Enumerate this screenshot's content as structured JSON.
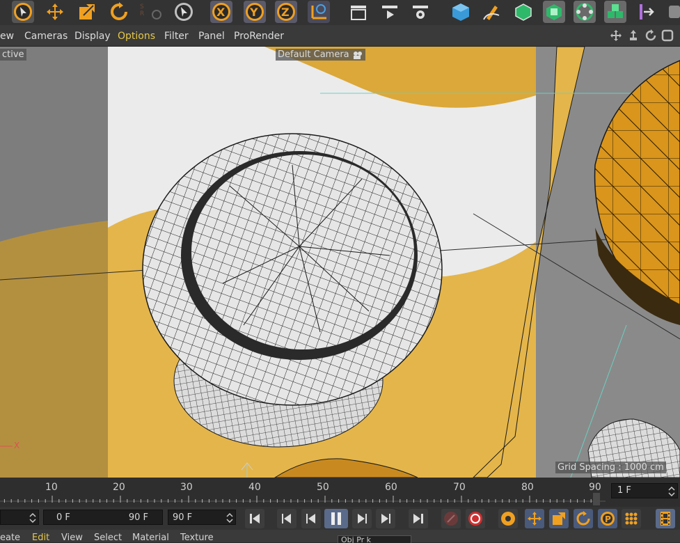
{
  "menu": {
    "items": [
      "ew",
      "Cameras",
      "Display",
      "Options",
      "Filter",
      "Panel",
      "ProRender"
    ],
    "highlighted": "Options"
  },
  "viewport": {
    "mode_label": "ctive",
    "camera_label": "Default Camera",
    "grid_spacing": "Grid Spacing : 1000 cm",
    "axis_x_label": "X"
  },
  "timeline": {
    "ticks": [
      "10",
      "20",
      "30",
      "40",
      "50",
      "60",
      "70",
      "80",
      "90"
    ],
    "current_frame": "1 F"
  },
  "controls": {
    "start_frame": "0 F",
    "end_frame": "90 F",
    "max_frame": "90 F"
  },
  "bottom_menu": {
    "items": [
      "eate",
      "Edit",
      "View",
      "Select",
      "Material",
      "Texture"
    ],
    "highlighted": "Edit",
    "panel_title": "Obj    Pr      k"
  },
  "colors": {
    "accent": "#e6c84a",
    "toolbar_bg": "#333333",
    "viewport_yellow": "#e4b54a"
  },
  "icons": {
    "toolbar": [
      "select-arrow-icon",
      "move-icon",
      "scale-icon",
      "rotate-icon",
      "xsr-icon",
      "live-select-icon",
      "axis-x-icon",
      "axis-y-icon",
      "axis-z-icon",
      "coordinate-system-icon",
      "render-region-icon",
      "render-view-icon",
      "render-settings-icon",
      "cube-icon",
      "pen-icon",
      "subdivision-icon",
      "extrude-icon",
      "mograph-icon",
      "array-icon",
      "deformer-icon",
      "scene-icon"
    ]
  }
}
